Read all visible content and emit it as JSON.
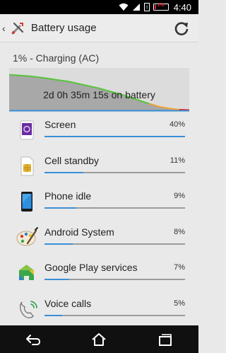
{
  "status_bar": {
    "battery_text": "1%",
    "time": "4:40",
    "icons": [
      "wifi-icon",
      "signal-icon",
      "no-sim-icon",
      "battery-icon"
    ]
  },
  "header": {
    "title": "Battery usage",
    "icons": [
      "up-caret-icon",
      "settings-tools-icon",
      "refresh-icon"
    ]
  },
  "summary": {
    "charge_status": "1% - Charging (AC)",
    "time_on_battery": "2d 0h 35m 15s on battery",
    "graph_level": [
      0.97,
      0.95,
      0.93,
      0.9,
      0.86,
      0.82,
      0.78,
      0.72,
      0.66,
      0.6,
      0.52,
      0.45,
      0.36,
      0.27,
      0.18,
      0.1,
      0.05,
      0.02,
      0.01
    ],
    "colors": {
      "graph_fill": "#a8a8a8",
      "line_green": "#57c43a",
      "line_orange": "#f0a030",
      "line_red": "#e0202e",
      "accent": "#3a8fd6"
    }
  },
  "usage": [
    {
      "name": "Screen",
      "percent": "40%",
      "value": 40,
      "icon": "screen-icon"
    },
    {
      "name": "Cell standby",
      "percent": "11%",
      "value": 11,
      "icon": "sim-card-icon"
    },
    {
      "name": "Phone idle",
      "percent": "9%",
      "value": 9,
      "icon": "phone-idle-icon"
    },
    {
      "name": "Android System",
      "percent": "8%",
      "value": 8,
      "icon": "android-system-icon"
    },
    {
      "name": "Google Play services",
      "percent": "7%",
      "value": 7,
      "icon": "google-play-services-icon"
    },
    {
      "name": "Voice calls",
      "percent": "5%",
      "value": 5,
      "icon": "phone-handset-icon"
    }
  ],
  "nav": {
    "icons": [
      "back-icon",
      "home-icon",
      "recents-icon"
    ]
  }
}
